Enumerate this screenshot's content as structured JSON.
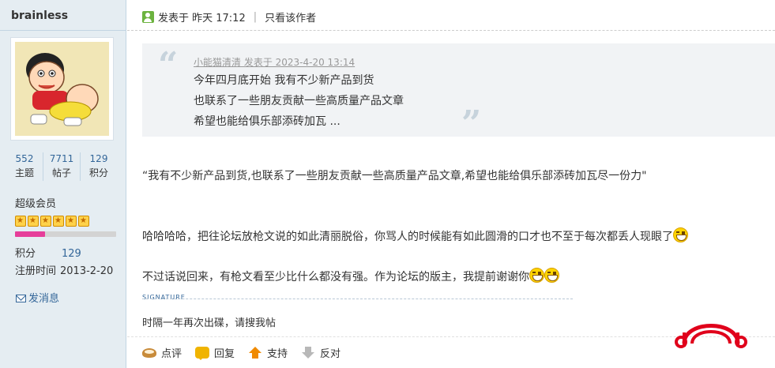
{
  "author": {
    "username": "brainless",
    "stats": [
      {
        "value": "552",
        "label": "主题"
      },
      {
        "value": "7711",
        "label": "帖子"
      },
      {
        "value": "129",
        "label": "积分"
      }
    ],
    "group": "超级会员",
    "stars": 6,
    "level_progress": 0.3,
    "info": [
      {
        "key": "积分",
        "value": "129"
      },
      {
        "key": "注册时间",
        "value": "2013-2-20"
      }
    ],
    "pm_label": "发消息"
  },
  "post": {
    "posted_at": "发表于 昨天 17:12",
    "only_author_label": "只看该作者",
    "quote": {
      "author_line": "小能猫清清 发表于 2023-4-20 13:14",
      "lines": [
        "今年四月底开始 我有不少新产品到货",
        "也联系了一些朋友贡献一些高质量产品文章",
        "希望也能给俱乐部添砖加瓦 ..."
      ]
    },
    "body": {
      "line1": "“我有不少新产品到货,也联系了一些朋友贡献一些高质量产品文章,希望也能给俱乐部添砖加瓦尽一份力\"",
      "line2": "哈哈哈哈，把往论坛放枪文说的如此清丽脱俗，你骂人的时候能有如此圆滑的口才也不至于每次都丢人现眼了",
      "line3": "不过话说回来，有枪文看至少比什么都没有强。作为论坛的版主，我提前谢谢你"
    },
    "signature_label": "SIGNATURE",
    "signature": "时隔一年再次出碟，请搜我帖",
    "actions": {
      "comment": "点评",
      "reply": "回复",
      "support": "支持",
      "oppose": "反对"
    }
  },
  "colors": {
    "sidebar_bg": "#e5edf2",
    "link": "#336699",
    "logo_red": "#e0001b",
    "progress_pink": "#e63e9a"
  }
}
